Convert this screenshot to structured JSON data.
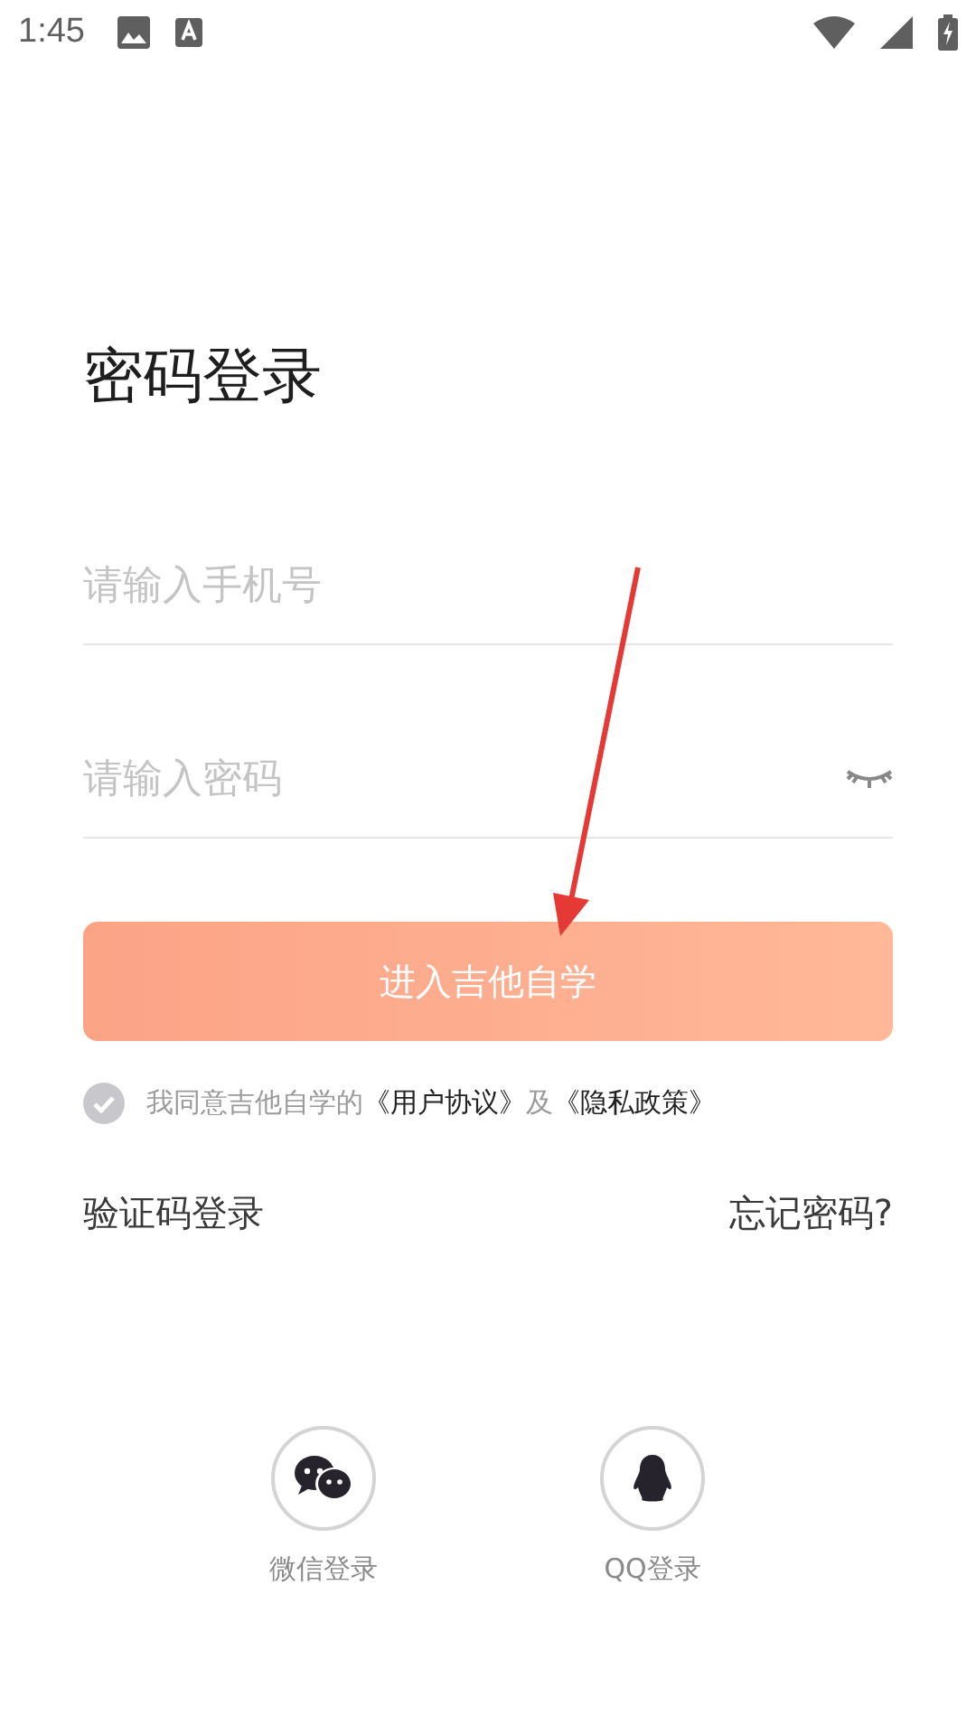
{
  "status_bar": {
    "time": "1:45"
  },
  "title": "密码登录",
  "phone_field": {
    "placeholder": "请输入手机号"
  },
  "password_field": {
    "placeholder": "请输入密码",
    "visible": false
  },
  "submit_button": {
    "label": "进入吉他自学"
  },
  "agreement": {
    "checked": true,
    "prefix": "我同意吉他自学的",
    "user_agreement": "《用户协议》",
    "joiner": "及",
    "privacy_policy": "《隐私政策》"
  },
  "links": {
    "sms_login": "验证码登录",
    "forgot_password": "忘记密码?"
  },
  "social_logins": [
    {
      "kind": "wechat",
      "label": "微信登录"
    },
    {
      "kind": "qq",
      "label": "QQ登录"
    }
  ]
}
